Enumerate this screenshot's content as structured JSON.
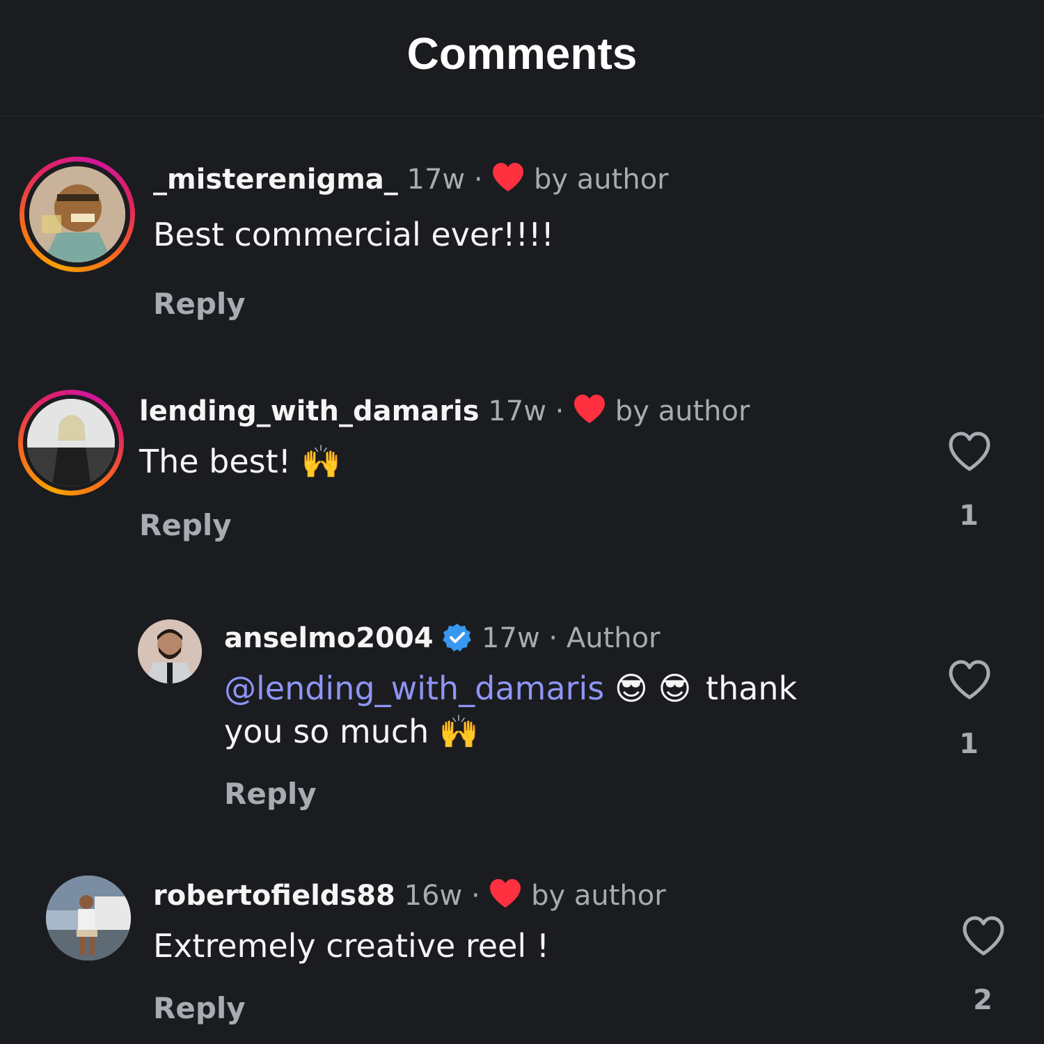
{
  "header": {
    "title": "Comments"
  },
  "comments": [
    {
      "username": "_misterenigma_",
      "age": "17w",
      "separator": "·",
      "author_liked_label": "by author",
      "text": "Best commercial ever!!!!",
      "reply_label": "Reply"
    },
    {
      "username": "lending_with_damaris",
      "age": "17w",
      "separator": "·",
      "author_liked_label": "by author",
      "text": "The best!",
      "emoji": "🙌",
      "reply_label": "Reply",
      "like_count": "1"
    },
    {
      "username": "anselmo2004",
      "verified": true,
      "age": "17w",
      "separator": "·",
      "role_label": "Author",
      "mention": "@lending_with_damaris",
      "emoji1": "😎",
      "emoji2": "😎",
      "text_line1": "thank",
      "text_line2": "you so much",
      "emoji3": "🙌",
      "reply_label": "Reply",
      "like_count": "1"
    },
    {
      "username": "robertofields88",
      "age": "16w",
      "separator": "·",
      "author_liked_label": "by author",
      "text": "Extremely creative reel !",
      "reply_label": "Reply",
      "like_count": "2"
    }
  ],
  "icons": {
    "author_heart": "heart-filled-icon",
    "like": "heart-outline-icon",
    "verified": "verified-badge-icon"
  },
  "colors": {
    "background": "#1a1c20",
    "author_heart": "#ff3040",
    "mention": "#8f95f4",
    "verified": "#3897f0",
    "muted_text": "#a8abb1"
  }
}
